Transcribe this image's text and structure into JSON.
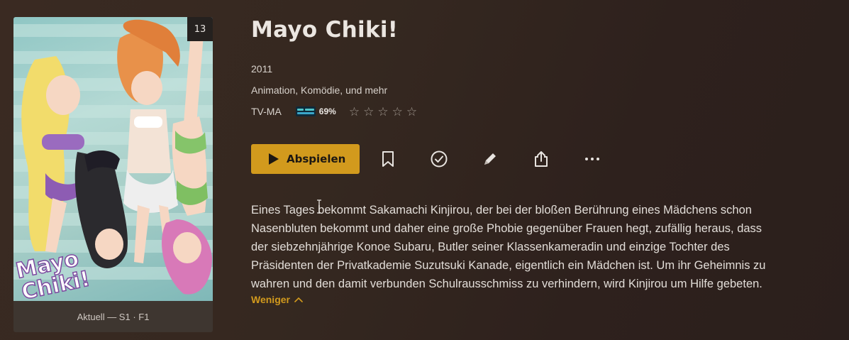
{
  "poster": {
    "badge": "13",
    "progress": "Aktuell — S1 · F1",
    "logo_text": "Mayo Chiki!"
  },
  "show": {
    "title": "Mayo Chiki!",
    "year": "2011",
    "genres": "Animation, Komödie, und mehr",
    "content_rating": "TV-MA",
    "rating_source_icon": "tmdb-icon",
    "score": "69%",
    "user_stars": 0,
    "user_stars_max": 5
  },
  "actions": {
    "play_label": "Abspielen",
    "icons": [
      "bookmark-icon",
      "check-circle-icon",
      "pencil-icon",
      "share-icon",
      "more-icon"
    ]
  },
  "description": {
    "lines": [
      "Eines Tages bekommt Sakamachi Kinjirou, der bei der bloßen Berührung eines Mädchens schon",
      "Nasenbluten bekommt und daher eine große Phobie gegenüber Frauen hegt, zufällig heraus, dass",
      "der siebzehnjährige Konoe Subaru, Butler seiner Klassenkameradin und einzige Tochter des",
      "Präsidenten der Privatkademie Suzutsuki Kanade, eigentlich ein Mädchen ist. Um ihr Geheimnis zu",
      "wahren und den damit verbunden Schulrausschmiss zu verhindern, wird Kinjirou um Hilfe gebeten."
    ],
    "toggle_label": "Weniger"
  },
  "colors": {
    "accent": "#d29a1d",
    "background": "#352820",
    "text": "#e8e4e0"
  }
}
